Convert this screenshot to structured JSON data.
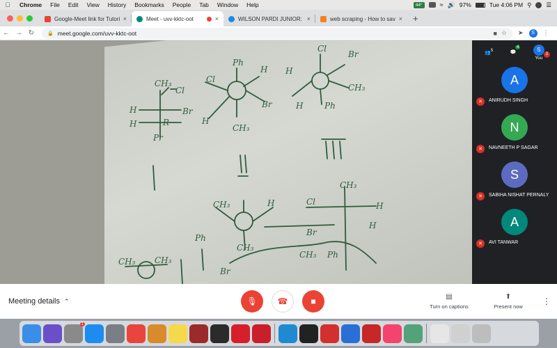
{
  "menubar": {
    "app": "Chrome",
    "items": [
      "File",
      "Edit",
      "View",
      "History",
      "Bookmarks",
      "People",
      "Tab",
      "Window",
      "Help"
    ],
    "badge": "44°",
    "battery": "97%",
    "clock": "Tue 4:06 PM"
  },
  "tabs": [
    {
      "title": "Google-Meet link for Tutorial c",
      "color": "#ea4335",
      "active": false
    },
    {
      "title": "Meet - uvv-kktc-oot",
      "color": "#00897b",
      "active": true
    },
    {
      "title": "WILSON PARDI JUNIOR: Softw",
      "color": "#1e88e5",
      "active": false
    },
    {
      "title": "web scraping - How to save an",
      "color": "#f48024",
      "active": false
    }
  ],
  "newtab": "+",
  "omnibox": {
    "url": "meet.google.com/uvv-kktc-oot",
    "profile": "S"
  },
  "panel": {
    "count": "5",
    "chat_badge": "4",
    "you_initial": "S",
    "you_label": "You",
    "you_badge": "3",
    "participants": [
      {
        "initial": "A",
        "name": "ANIRUDH SINGH",
        "color": "#1a73e8"
      },
      {
        "initial": "N",
        "name": "NAVNEETH P SAGAR",
        "color": "#34a853"
      },
      {
        "initial": "S",
        "name": "SABIHA NISHAT PERNALY",
        "color": "#5c6bc0"
      },
      {
        "initial": "A",
        "name": "AVI TANWAR",
        "color": "#00897b"
      }
    ]
  },
  "bottom": {
    "details": "Meeting details",
    "captions": "Turn on captions",
    "present": "Present now"
  },
  "dock": {
    "apps": [
      {
        "icon": "finder-icon",
        "color": "#3a8ee6"
      },
      {
        "icon": "siri-icon",
        "color": "#6a4fc9"
      },
      {
        "icon": "system-preferences-icon",
        "color": "#8a8a8a",
        "badge": "1"
      },
      {
        "icon": "safari-icon",
        "color": "#1d8cf0"
      },
      {
        "icon": "launchpad-icon",
        "color": "#7a7f86"
      },
      {
        "icon": "chrome-icon",
        "color": "#e8453c"
      },
      {
        "icon": "calculator-icon",
        "color": "#d98a2a"
      },
      {
        "icon": "notes-icon",
        "color": "#f6d94b"
      },
      {
        "icon": "dictionary-icon",
        "color": "#9b2b2b"
      },
      {
        "icon": "quicktime-icon",
        "color": "#2b2b2b"
      },
      {
        "icon": "opera-icon",
        "color": "#d71f2b"
      },
      {
        "icon": "autocad-icon",
        "color": "#c81f2a"
      },
      {
        "icon": "vscode-icon",
        "color": "#1f8ad2"
      },
      {
        "icon": "terminal-icon",
        "color": "#222222"
      },
      {
        "icon": "acrobat-icon",
        "color": "#d32f2f"
      },
      {
        "icon": "bluetooth-icon",
        "color": "#2a6fd6"
      },
      {
        "icon": "app-red-icon",
        "color": "#c62828"
      },
      {
        "icon": "music-icon",
        "color": "#f4436c"
      },
      {
        "icon": "atom-icon",
        "color": "#52a37a"
      },
      {
        "icon": "document-icon",
        "color": "#e6e6e6"
      },
      {
        "icon": "chrome-window-icon",
        "color": "#d0d0d0"
      },
      {
        "icon": "trash-icon",
        "color": "#bdbdbd"
      }
    ]
  }
}
